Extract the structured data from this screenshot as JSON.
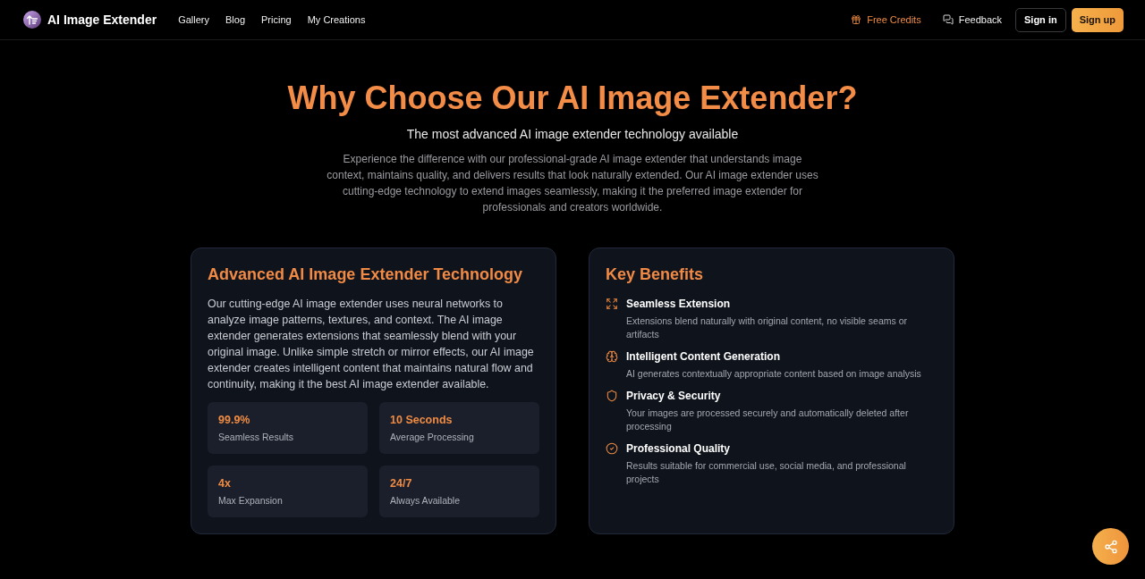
{
  "nav": {
    "brand": "AI Image Extender",
    "links": [
      "Gallery",
      "Blog",
      "Pricing",
      "My Creations"
    ],
    "free_credits": "Free Credits",
    "feedback": "Feedback",
    "sign_in": "Sign in",
    "sign_up": "Sign up"
  },
  "hero": {
    "title": "Why Choose Our AI Image Extender?",
    "subtitle": "The most advanced AI image extender technology available",
    "description": "Experience the difference with our professional-grade AI image extender that understands image context, maintains quality, and delivers results that look naturally extended. Our AI image extender uses cutting-edge technology to extend images seamlessly, making it the preferred image extender for professionals and creators worldwide."
  },
  "technology_card": {
    "title": "Advanced AI Image Extender Technology",
    "body": "Our cutting-edge AI image extender uses neural networks to analyze image patterns, textures, and context. The AI image extender generates extensions that seamlessly blend with your original image. Unlike simple stretch or mirror effects, our AI image extender creates intelligent content that maintains natural flow and continuity, making it the best AI image extender available.",
    "stats": [
      {
        "value": "99.9%",
        "label": "Seamless Results"
      },
      {
        "value": "10 Seconds",
        "label": "Average Processing"
      },
      {
        "value": "4x",
        "label": "Max Expansion"
      },
      {
        "value": "24/7",
        "label": "Always Available"
      }
    ]
  },
  "benefits_card": {
    "title": "Key Benefits",
    "items": [
      {
        "title": "Seamless Extension",
        "description": "Extensions blend naturally with original content, no visible seams or artifacts"
      },
      {
        "title": "Intelligent Content Generation",
        "description": "AI generates contextually appropriate content based on image analysis"
      },
      {
        "title": "Privacy & Security",
        "description": "Your images are processed securely and automatically deleted after processing"
      },
      {
        "title": "Professional Quality",
        "description": "Results suitable for commercial use, social media, and professional projects"
      }
    ]
  }
}
